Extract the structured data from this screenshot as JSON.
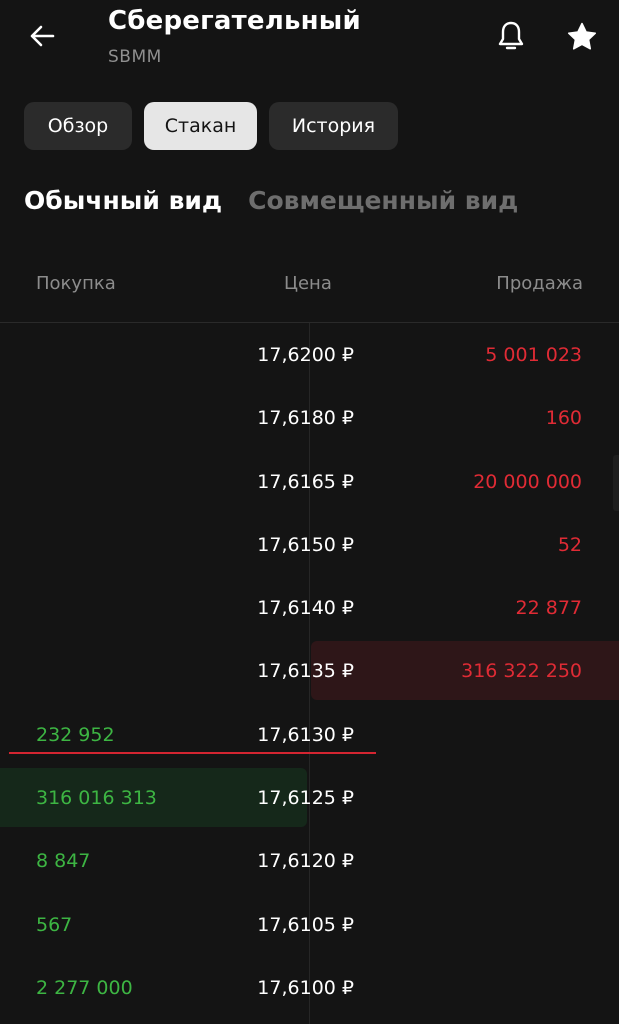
{
  "header": {
    "title": "Сберегательный",
    "ticker": "SBMM",
    "icons": {
      "back": "arrow-left-icon",
      "notify": "bell-icon",
      "favorite": "star-icon"
    }
  },
  "tabs": [
    {
      "label": "Обзор",
      "active": false
    },
    {
      "label": "Стакан",
      "active": true
    },
    {
      "label": "История",
      "active": false
    }
  ],
  "view_modes": [
    {
      "label": "Обычный вид",
      "active": true
    },
    {
      "label": "Совмещенный вид",
      "active": false
    }
  ],
  "columns": {
    "buy": "Покупка",
    "price": "Цена",
    "sell": "Продажа"
  },
  "order_book": [
    {
      "buy": "",
      "price": "17,6200 ₽",
      "sell": "5 001 023"
    },
    {
      "buy": "",
      "price": "17,6180 ₽",
      "sell": "160"
    },
    {
      "buy": "",
      "price": "17,6165 ₽",
      "sell": "20 000 000"
    },
    {
      "buy": "",
      "price": "17,6150 ₽",
      "sell": "52"
    },
    {
      "buy": "",
      "price": "17,6140 ₽",
      "sell": "22 877"
    },
    {
      "buy": "",
      "price": "17,6135 ₽",
      "sell": "316 322 250"
    },
    {
      "buy": "232 952",
      "price": "17,6130 ₽",
      "sell": ""
    },
    {
      "buy": "316 016 313",
      "price": "17,6125 ₽",
      "sell": ""
    },
    {
      "buy": "8 847",
      "price": "17,6120 ₽",
      "sell": ""
    },
    {
      "buy": "567",
      "price": "17,6105 ₽",
      "sell": ""
    },
    {
      "buy": "2 277 000",
      "price": "17,6100 ₽",
      "sell": ""
    }
  ],
  "colors": {
    "background": "#141414",
    "buy": "#3db543",
    "sell": "#e02b35",
    "spread_line": "#d42531",
    "tab_active_bg": "#e6e6e6",
    "tab_bg": "#2b2b2b"
  }
}
